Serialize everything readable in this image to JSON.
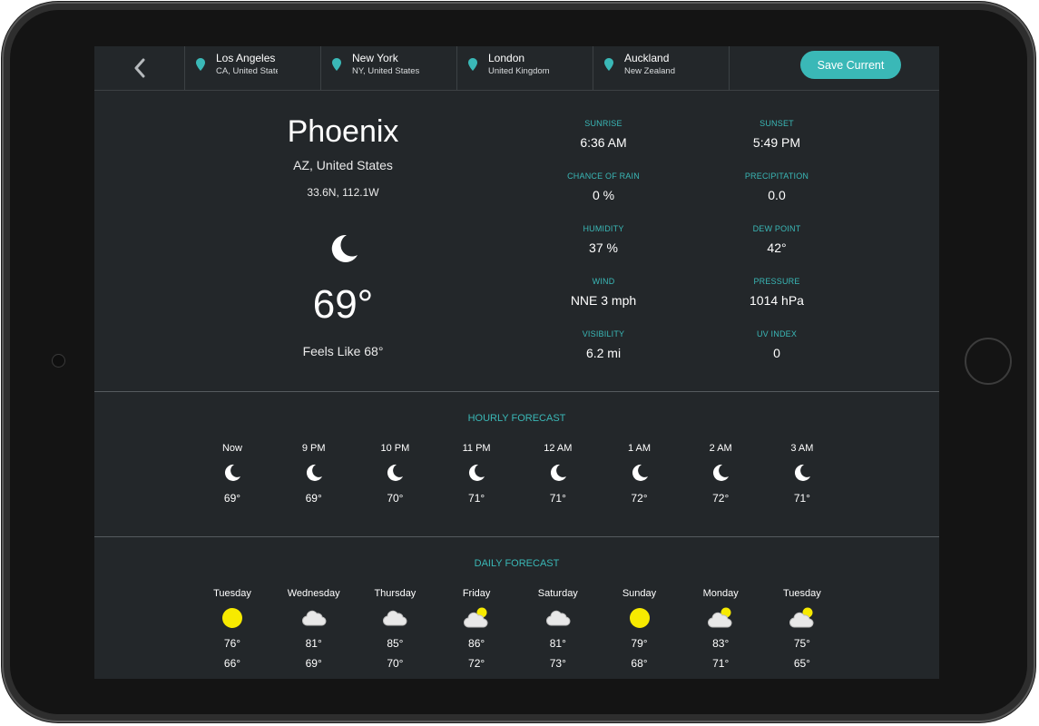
{
  "nav": {
    "back_icon": "chevron-left-icon",
    "locations": [
      {
        "city": "Los Angeles",
        "region": "CA, United States"
      },
      {
        "city": "New York",
        "region": "NY, United States"
      },
      {
        "city": "London",
        "region": "United Kingdom"
      },
      {
        "city": "Auckland",
        "region": "New Zealand"
      }
    ],
    "save_label": "Save Current"
  },
  "current": {
    "city": "Phoenix",
    "region": "AZ, United States",
    "coords": "33.6N, 112.1W",
    "icon": "moon-icon",
    "temp": "69°",
    "feels_like": "Feels Like 68°"
  },
  "stats": [
    {
      "label": "SUNRISE",
      "value": "6:36 AM"
    },
    {
      "label": "SUNSET",
      "value": "5:49 PM"
    },
    {
      "label": "CHANCE OF RAIN",
      "value": "0 %"
    },
    {
      "label": "PRECIPITATION",
      "value": "0.0"
    },
    {
      "label": "HUMIDITY",
      "value": "37 %"
    },
    {
      "label": "DEW POINT",
      "value": "42°"
    },
    {
      "label": "WIND",
      "value": "NNE 3 mph"
    },
    {
      "label": "PRESSURE",
      "value": "1014 hPa"
    },
    {
      "label": "VISIBILITY",
      "value": "6.2 mi"
    },
    {
      "label": "UV INDEX",
      "value": "0"
    }
  ],
  "hourly": {
    "title": "HOURLY FORECAST",
    "items": [
      {
        "time": "Now",
        "icon": "moon-icon",
        "temp": "69°"
      },
      {
        "time": "9 PM",
        "icon": "moon-icon",
        "temp": "69°"
      },
      {
        "time": "10 PM",
        "icon": "moon-icon",
        "temp": "70°"
      },
      {
        "time": "11 PM",
        "icon": "moon-icon",
        "temp": "71°"
      },
      {
        "time": "12 AM",
        "icon": "moon-icon",
        "temp": "71°"
      },
      {
        "time": "1 AM",
        "icon": "moon-icon",
        "temp": "72°"
      },
      {
        "time": "2 AM",
        "icon": "moon-icon",
        "temp": "72°"
      },
      {
        "time": "3 AM",
        "icon": "moon-icon",
        "temp": "71°"
      }
    ]
  },
  "daily": {
    "title": "DAILY FORECAST",
    "items": [
      {
        "day": "Tuesday",
        "icon": "sun-icon",
        "high": "76°",
        "low": "66°"
      },
      {
        "day": "Wednesday",
        "icon": "cloud-icon",
        "high": "81°",
        "low": "69°"
      },
      {
        "day": "Thursday",
        "icon": "cloud-icon",
        "high": "85°",
        "low": "70°"
      },
      {
        "day": "Friday",
        "icon": "partly-cloudy-icon",
        "high": "86°",
        "low": "72°"
      },
      {
        "day": "Saturday",
        "icon": "cloud-icon",
        "high": "81°",
        "low": "73°"
      },
      {
        "day": "Sunday",
        "icon": "sun-icon",
        "high": "79°",
        "low": "68°"
      },
      {
        "day": "Monday",
        "icon": "partly-cloudy-icon",
        "high": "83°",
        "low": "71°"
      },
      {
        "day": "Tuesday",
        "icon": "partly-cloudy-icon",
        "high": "75°",
        "low": "65°"
      }
    ]
  },
  "colors": {
    "accent": "#3ab8b7",
    "screen_bg": "#23272a",
    "sun": "#f7ea00"
  }
}
